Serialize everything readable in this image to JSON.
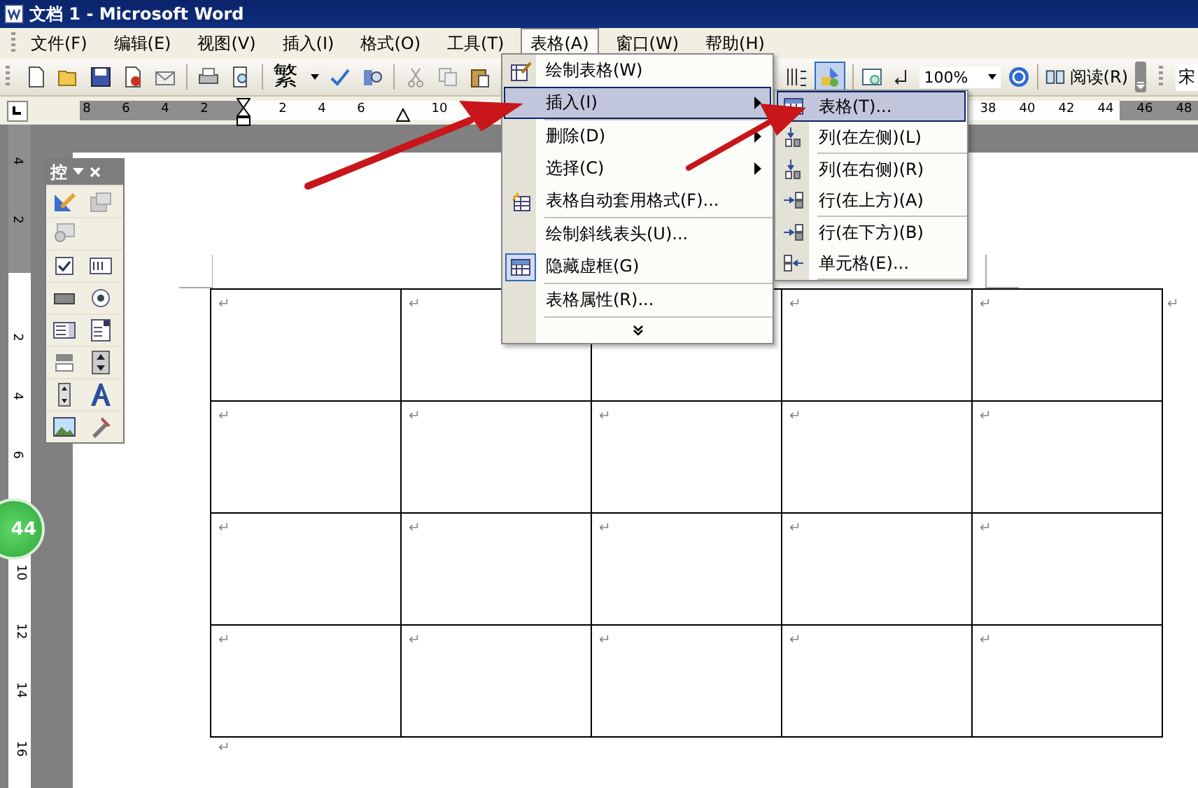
{
  "window": {
    "title": "文档 1 - Microsoft Word"
  },
  "menu_bar": [
    {
      "label": "文件(F)",
      "selected": false
    },
    {
      "label": "编辑(E)",
      "selected": false
    },
    {
      "label": "视图(V)",
      "selected": false
    },
    {
      "label": "插入(I)",
      "selected": false
    },
    {
      "label": "格式(O)",
      "selected": false
    },
    {
      "label": "工具(T)",
      "selected": false
    },
    {
      "label": "表格(A)",
      "selected": true
    },
    {
      "label": "窗口(W)",
      "selected": false
    },
    {
      "label": "帮助(H)",
      "selected": false
    }
  ],
  "toolbar": {
    "chinese_convert": "繁",
    "drawing_pressed": true,
    "zoom": "100%",
    "read_button": "阅读(R)",
    "font_field": "宋"
  },
  "ruler": {
    "ticks": [
      "8",
      "6",
      "4",
      "2",
      "2",
      "4",
      "6",
      "10",
      "38",
      "40",
      "42",
      "44",
      "46",
      "48"
    ]
  },
  "vertical_ruler": {
    "ticks": [
      "4",
      "2",
      "2",
      "4",
      "6",
      "10",
      "12",
      "14",
      "16"
    ]
  },
  "page_badge": "44",
  "controls_toolbox": {
    "title": "控"
  },
  "table_menu": {
    "items": [
      {
        "label": "绘制表格(W)",
        "selected": false,
        "has_submenu": false,
        "checked": false
      },
      {
        "label": "插入(I)",
        "selected": true,
        "has_submenu": true,
        "checked": false
      },
      {
        "label": "删除(D)",
        "selected": false,
        "has_submenu": true,
        "checked": false
      },
      {
        "label": "选择(C)",
        "selected": false,
        "has_submenu": true,
        "checked": false
      },
      {
        "label": "表格自动套用格式(F)...",
        "selected": false,
        "has_submenu": false,
        "checked": false
      },
      {
        "label": "绘制斜线表头(U)...",
        "selected": false,
        "has_submenu": false,
        "checked": false
      },
      {
        "label": "隐藏虚框(G)",
        "selected": false,
        "has_submenu": false,
        "checked": true
      },
      {
        "label": "表格属性(R)...",
        "selected": false,
        "has_submenu": false,
        "checked": false
      }
    ]
  },
  "insert_submenu": {
    "items": [
      {
        "label": "表格(T)...",
        "selected": true
      },
      {
        "label": "列(在左侧)(L)",
        "selected": false
      },
      {
        "label": "列(在右侧)(R)",
        "selected": false
      },
      {
        "label": "行(在上方)(A)",
        "selected": false
      },
      {
        "label": "行(在下方)(B)",
        "selected": false
      },
      {
        "label": "单元格(E)...",
        "selected": false
      }
    ]
  },
  "document": {
    "table": {
      "rows": [
        {
          "cells": [
            "↵",
            "↵",
            null,
            "↵",
            "↵"
          ],
          "end_mark": "↵"
        },
        {
          "cells": [
            "↵",
            "↵",
            "↵",
            "↵",
            "↵"
          ]
        },
        {
          "cells": [
            "↵",
            "↵",
            "↵",
            "↵",
            "↵"
          ]
        },
        {
          "cells": [
            "↵",
            "↵",
            "↵",
            "↵",
            "↵"
          ]
        }
      ]
    },
    "after_mark": "↵"
  }
}
